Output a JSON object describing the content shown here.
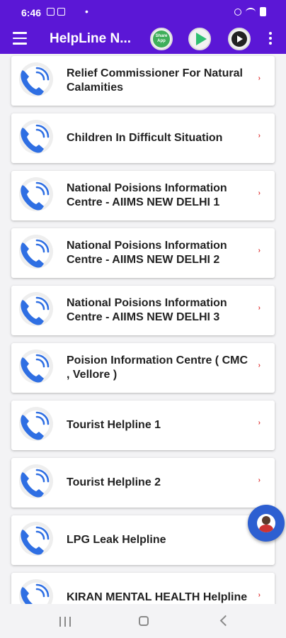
{
  "status_bar": {
    "time": "6:46",
    "dot": "•"
  },
  "app_bar": {
    "title": "HelpLine N...",
    "share_app_label": "Share App",
    "icons": [
      "menu-icon",
      "share-app-icon",
      "play-store-icon",
      "more-apps-icon",
      "kebab-icon"
    ]
  },
  "helplines": [
    {
      "label": "Relief Commissioner For Natural Calamities"
    },
    {
      "label": "Children In Difficult Situation"
    },
    {
      "label": "National Poisions Information Centre - AIIMS NEW DELHI 1"
    },
    {
      "label": "National Poisions Information Centre - AIIMS NEW DELHI 2"
    },
    {
      "label": "National Poisions Information Centre - AIIMS NEW DELHI 3"
    },
    {
      "label": "Poision Information Centre ( CMC , Vellore )"
    },
    {
      "label": "Tourist Helpline 1"
    },
    {
      "label": "Tourist Helpline 2"
    },
    {
      "label": "LPG Leak Helpline"
    },
    {
      "label": "KIRAN MENTAL HEALTH Helpline"
    }
  ],
  "row_arrow": "›",
  "colors": {
    "primary": "#5b17d6",
    "phone_blue": "#2f6fe3",
    "arrow_red": "#e03a3a",
    "fab_blue": "#2d5fd1"
  }
}
